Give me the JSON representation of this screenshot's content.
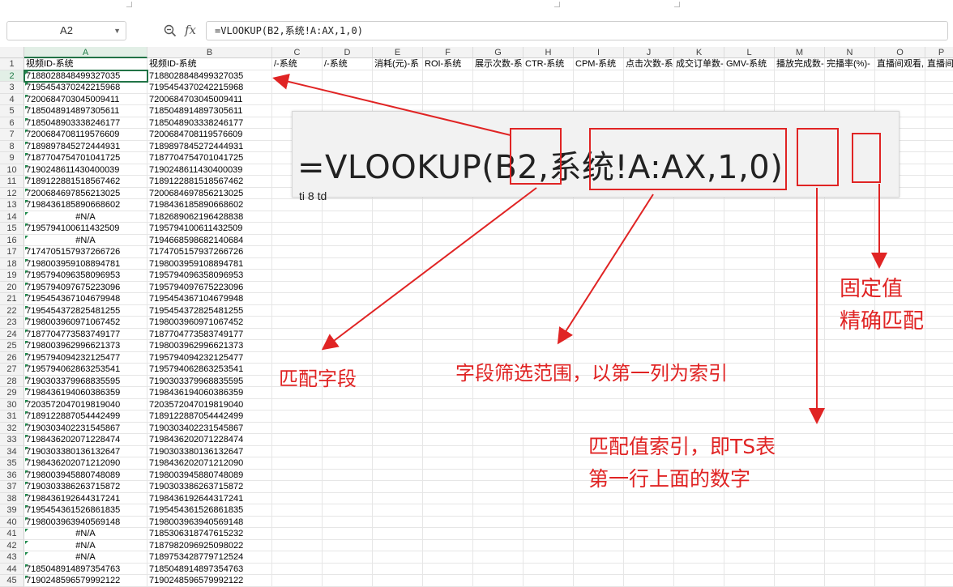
{
  "name_box": {
    "value": "A2"
  },
  "formula_bar": {
    "fx_label": "fx",
    "formula": "=VLOOKUP(B2,系统!A:AX,1,0)"
  },
  "columns": [
    "A",
    "B",
    "C",
    "D",
    "E",
    "F",
    "G",
    "H",
    "I",
    "J",
    "K",
    "L",
    "M",
    "N",
    "O",
    "P"
  ],
  "header_row": [
    "视频ID-系统",
    "视频ID-系统",
    "/-系统",
    "/-系统",
    "消耗(元)-系",
    "ROI-系统",
    "展示次数-系",
    "CTR-系统",
    "CPM-系统",
    "点击次数-系",
    "成交订单数-",
    "GMV-系统",
    "播放完成数-",
    "完播率(%)-",
    "直播间观看,",
    "直播间"
  ],
  "rows": [
    {
      "num": "2",
      "a": "7188028848499327035",
      "b": "7188028848499327035"
    },
    {
      "num": "3",
      "a": "7195454370242215968",
      "b": "7195454370242215968"
    },
    {
      "num": "4",
      "a": "7200684703045009411",
      "b": "7200684703045009411"
    },
    {
      "num": "5",
      "a": "7185048914897305611",
      "b": "7185048914897305611"
    },
    {
      "num": "6",
      "a": "7185048903338246177",
      "b": "7185048903338246177"
    },
    {
      "num": "7",
      "a": "7200684708119576609",
      "b": "7200684708119576609"
    },
    {
      "num": "8",
      "a": "7189897845272444931",
      "b": "7189897845272444931"
    },
    {
      "num": "9",
      "a": "7187704754701041725",
      "b": "7187704754701041725"
    },
    {
      "num": "10",
      "a": "7190248611430400039",
      "b": "7190248611430400039"
    },
    {
      "num": "11",
      "a": "7189122881518567462",
      "b": "7189122881518567462"
    },
    {
      "num": "12",
      "a": "7200684697856213025",
      "b": "7200684697856213025"
    },
    {
      "num": "13",
      "a": "7198436185890668602",
      "b": "7198436185890668602"
    },
    {
      "num": "14",
      "a": "#N/A",
      "b": "7182689062196428838"
    },
    {
      "num": "15",
      "a": "7195794100611432509",
      "b": "7195794100611432509"
    },
    {
      "num": "16",
      "a": "#N/A",
      "b": "7194668598682140684"
    },
    {
      "num": "17",
      "a": "7174705157937266726",
      "b": "7174705157937266726"
    },
    {
      "num": "18",
      "a": "7198003959108894781",
      "b": "7198003959108894781"
    },
    {
      "num": "19",
      "a": "7195794096358096953",
      "b": "7195794096358096953"
    },
    {
      "num": "20",
      "a": "7195794097675223096",
      "b": "7195794097675223096"
    },
    {
      "num": "21",
      "a": "7195454367104679948",
      "b": "7195454367104679948"
    },
    {
      "num": "22",
      "a": "7195454372825481255",
      "b": "7195454372825481255"
    },
    {
      "num": "23",
      "a": "7198003960971067452",
      "b": "7198003960971067452"
    },
    {
      "num": "24",
      "a": "7187704773583749177",
      "b": "7187704773583749177"
    },
    {
      "num": "25",
      "a": "7198003962996621373",
      "b": "7198003962996621373"
    },
    {
      "num": "26",
      "a": "7195794094232125477",
      "b": "7195794094232125477"
    },
    {
      "num": "27",
      "a": "7195794062863253541",
      "b": "7195794062863253541"
    },
    {
      "num": "28",
      "a": "7190303379968835595",
      "b": "7190303379968835595"
    },
    {
      "num": "29",
      "a": "7198436194060386359",
      "b": "7198436194060386359"
    },
    {
      "num": "30",
      "a": "7203572047019819040",
      "b": "7203572047019819040"
    },
    {
      "num": "31",
      "a": "7189122887054442499",
      "b": "7189122887054442499"
    },
    {
      "num": "32",
      "a": "7190303402231545867",
      "b": "7190303402231545867"
    },
    {
      "num": "33",
      "a": "7198436202071228474",
      "b": "7198436202071228474"
    },
    {
      "num": "34",
      "a": "7190303380136132647",
      "b": "7190303380136132647"
    },
    {
      "num": "35",
      "a": "7198436202071212090",
      "b": "7198436202071212090"
    },
    {
      "num": "36",
      "a": "7198003945880748089",
      "b": "7198003945880748089"
    },
    {
      "num": "37",
      "a": "7190303386263715872",
      "b": "7190303386263715872"
    },
    {
      "num": "38",
      "a": "7198436192644317241",
      "b": "7198436192644317241"
    },
    {
      "num": "39",
      "a": "7195454361526861835",
      "b": "7195454361526861835"
    },
    {
      "num": "40",
      "a": "7198003963940569148",
      "b": "7198003963940569148"
    },
    {
      "num": "41",
      "a": "#N/A",
      "b": "7185306318747615232"
    },
    {
      "num": "42",
      "a": "#N/A",
      "b": "7187982096925098022"
    },
    {
      "num": "43",
      "a": "#N/A",
      "b": "7189753428779712524"
    },
    {
      "num": "44",
      "a": "7185048914897354763",
      "b": "7185048914897354763"
    },
    {
      "num": "45",
      "a": "7190248596579992122",
      "b": "7190248596579992122"
    }
  ],
  "overlay": {
    "formula_zoom": "=VLOOKUP(B2,系统!A:AX,1,0)",
    "cut_text": "ti 8 td"
  },
  "annotations": {
    "match_field": "匹配字段",
    "range": "字段筛选范围，以第一列为索引",
    "index_line1": "匹配值索引，即TS表",
    "index_line2": "第一行上面的数字",
    "fixed_line1": "固定值",
    "fixed_line2": "精确匹配"
  },
  "colors": {
    "annotation": "#e02424",
    "selection": "#217346"
  }
}
